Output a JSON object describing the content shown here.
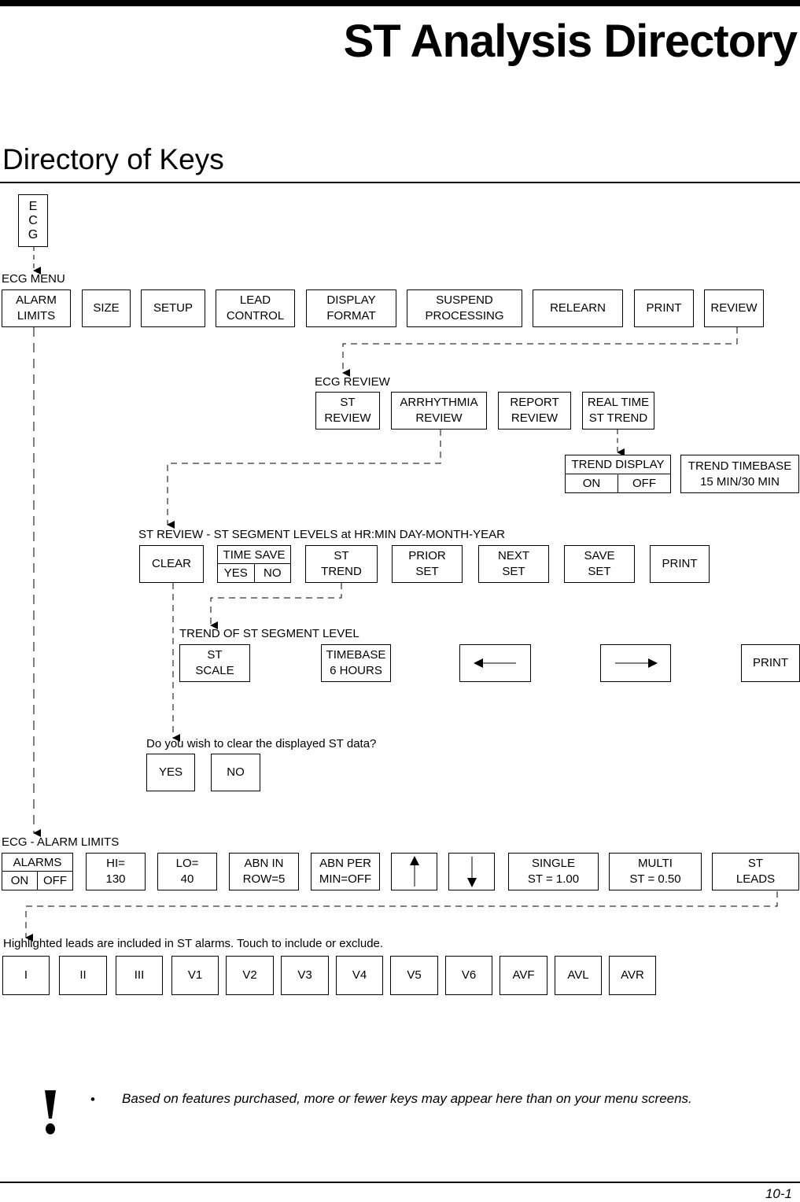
{
  "header": {
    "title": "ST Analysis Directory",
    "section_title": "Directory of Keys"
  },
  "ecg_key": {
    "letters": [
      "E",
      "C",
      "G"
    ]
  },
  "ecg_menu": {
    "label": "ECG MENU",
    "keys": [
      {
        "line1": "ALARM",
        "line2": "LIMITS"
      },
      {
        "line1": "SIZE",
        "line2": ""
      },
      {
        "line1": "SETUP",
        "line2": ""
      },
      {
        "line1": "LEAD",
        "line2": "CONTROL"
      },
      {
        "line1": "DISPLAY",
        "line2": "FORMAT"
      },
      {
        "line1": "SUSPEND",
        "line2": "PROCESSING"
      },
      {
        "line1": "RELEARN",
        "line2": ""
      },
      {
        "line1": "PRINT",
        "line2": ""
      },
      {
        "line1": "REVIEW",
        "line2": ""
      }
    ]
  },
  "ecg_review": {
    "label": "ECG REVIEW",
    "keys": [
      {
        "line1": "ST",
        "line2": "REVIEW"
      },
      {
        "line1": "ARRHYTHMIA",
        "line2": "REVIEW"
      },
      {
        "line1": "REPORT",
        "line2": "REVIEW"
      },
      {
        "line1": "REAL TIME",
        "line2": "ST TREND"
      }
    ],
    "trend_display": {
      "title": "TREND DISPLAY",
      "on": "ON",
      "off": "OFF"
    },
    "trend_timebase": {
      "line1": "TREND TIMEBASE",
      "line2": "15 MIN/30 MIN"
    }
  },
  "st_review": {
    "label": "ST REVIEW - ST SEGMENT LEVELS at HR:MIN DAY-MONTH-YEAR",
    "clear": "CLEAR",
    "time_save": {
      "title": "TIME SAVE",
      "yes": "YES",
      "no": "NO"
    },
    "keys": [
      {
        "line1": "ST",
        "line2": "TREND"
      },
      {
        "line1": "PRIOR",
        "line2": "SET"
      },
      {
        "line1": "NEXT",
        "line2": "SET"
      },
      {
        "line1": "SAVE",
        "line2": "SET"
      },
      {
        "line1": "PRINT",
        "line2": ""
      }
    ]
  },
  "trend_st": {
    "label": "TREND OF ST SEGMENT LEVEL",
    "st_scale": {
      "line1": "ST",
      "line2": "SCALE"
    },
    "timebase": {
      "line1": "TIMEBASE",
      "line2": "6 HOURS"
    },
    "left_icon": "arrow-left",
    "right_icon": "arrow-right",
    "print": "PRINT"
  },
  "clear_confirm": {
    "label": "Do you wish to clear the displayed ST data?",
    "yes": "YES",
    "no": "NO"
  },
  "alarm_limits": {
    "label": "ECG - ALARM LIMITS",
    "alarms": {
      "title": "ALARMS",
      "on": "ON",
      "off": "OFF"
    },
    "keys": [
      {
        "line1": "HI=",
        "line2": "130"
      },
      {
        "line1": "LO=",
        "line2": "40"
      },
      {
        "line1": "ABN IN",
        "line2": "ROW=5"
      },
      {
        "line1": "ABN PER",
        "line2": "MIN=OFF"
      }
    ],
    "up_icon": "arrow-up",
    "down_icon": "arrow-down",
    "keys2": [
      {
        "line1": "SINGLE",
        "line2": "ST = 1.00"
      },
      {
        "line1": "MULTI",
        "line2": "ST = 0.50"
      },
      {
        "line1": "ST",
        "line2": "LEADS"
      }
    ]
  },
  "st_leads": {
    "label": "Highlighted leads are included in ST alarms. Touch to include or exclude.",
    "leads": [
      "I",
      "II",
      "III",
      "V1",
      "V2",
      "V3",
      "V4",
      "V5",
      "V6",
      "AVF",
      "AVL",
      "AVR"
    ]
  },
  "note": {
    "icon": "exclamation",
    "bullet": "•",
    "text": "Based on features purchased, more or fewer keys may appear here than on your menu screens."
  },
  "footer": {
    "page_number": "10-1"
  }
}
